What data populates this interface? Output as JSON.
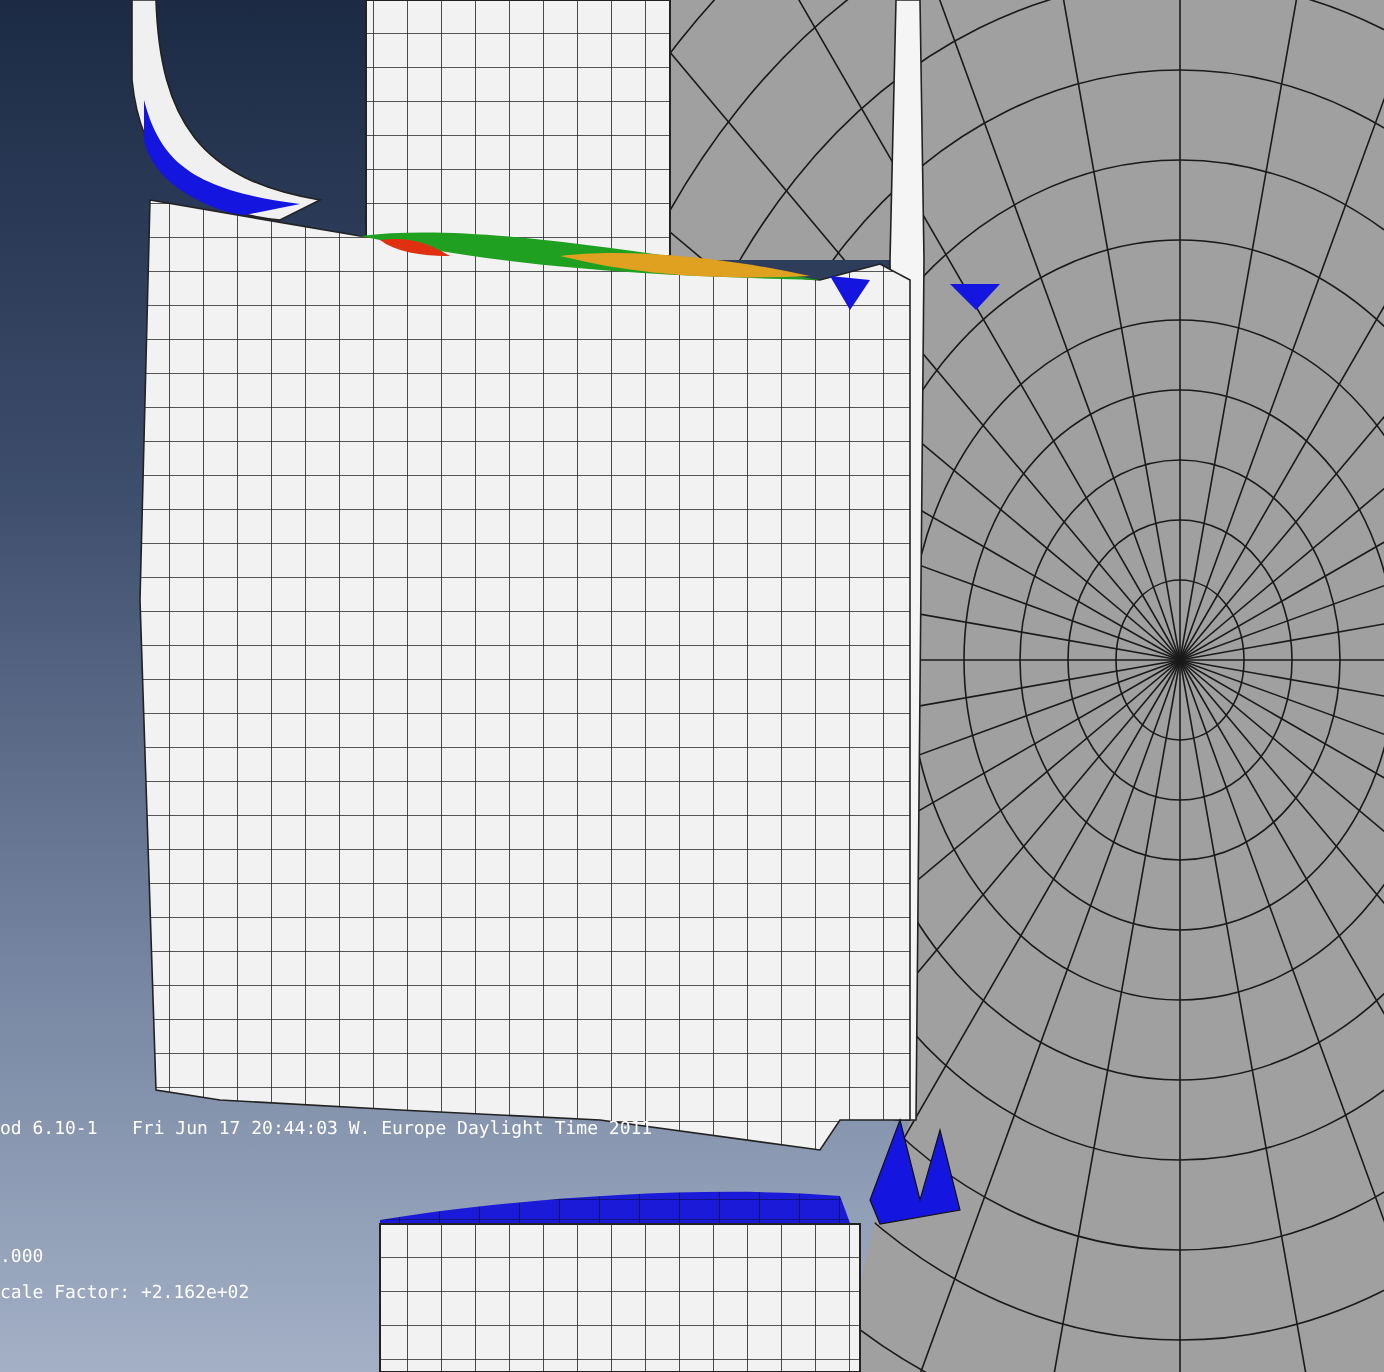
{
  "viewport": {
    "version": "od 6.10-1",
    "timestamp": "Fri Jun 17 20:44:03 W. Europe Daylight Time 2011",
    "step_value": ".000",
    "scale_factor": "cale Factor: +2.162e+02"
  }
}
